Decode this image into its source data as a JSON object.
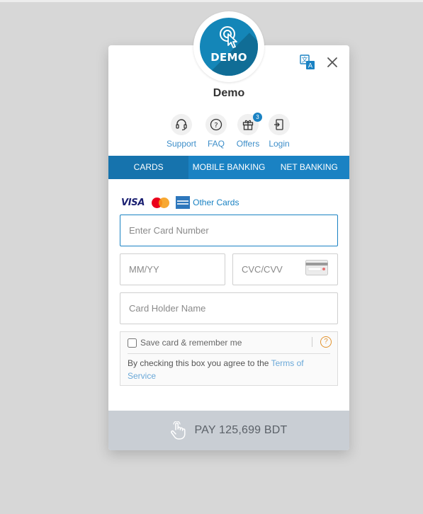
{
  "merchant": {
    "logo_text": "DEMO",
    "name": "Demo"
  },
  "header_actions": {
    "translate_icon": "translate-icon",
    "close_icon": "close-icon"
  },
  "quick_links": [
    {
      "label": "Support",
      "icon": "headset-icon"
    },
    {
      "label": "FAQ",
      "icon": "question-icon"
    },
    {
      "label": "Offers",
      "icon": "gift-icon",
      "badge": "3"
    },
    {
      "label": "Login",
      "icon": "login-icon"
    }
  ],
  "tabs": [
    {
      "label": "CARDS",
      "active": true
    },
    {
      "label": "MOBILE BANKING",
      "active": false
    },
    {
      "label": "NET BANKING",
      "active": false
    }
  ],
  "card_brands": {
    "visa": "VISA",
    "other_cards": "Other Cards"
  },
  "form": {
    "card_number_placeholder": "Enter Card Number",
    "expiry_placeholder": "MM/YY",
    "cvc_placeholder": "CVC/CVV",
    "holder_placeholder": "Card Holder Name"
  },
  "save_card": {
    "label": "Save card & remember me",
    "checked": false,
    "help": "?",
    "terms_prefix": "By checking this box you agree to the ",
    "terms_link": "Terms of Service"
  },
  "pay": {
    "label": "PAY 125,699 BDT"
  },
  "colors": {
    "accent": "#1a82c3",
    "accent_active": "#1673ad",
    "help": "#e2922d",
    "pay_bg": "#c9ced4"
  }
}
